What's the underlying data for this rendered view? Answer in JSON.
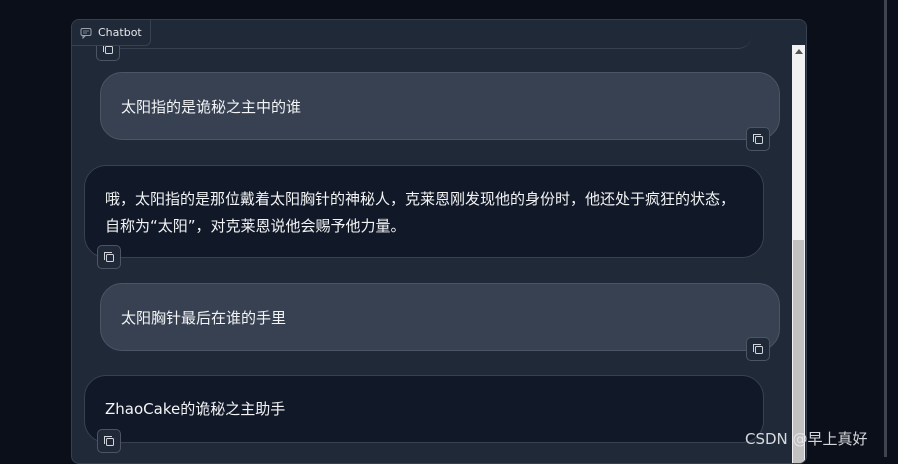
{
  "panel": {
    "label": "Chatbot",
    "label_icon": "chat-icon"
  },
  "messages": [
    {
      "role": "user",
      "text": "太阳指的是诡秘之主中的谁"
    },
    {
      "role": "bot",
      "text": "哦，太阳指的是那位戴着太阳胸针的神秘人，克莱恩刚发现他的身份时，他还处于疯狂的状态，自称为“太阳”，对克莱恩说他会赐予他力量。"
    },
    {
      "role": "user",
      "text": "太阳胸针最后在谁的手里"
    },
    {
      "role": "bot",
      "text": "ZhaoCake的诡秘之主助手"
    }
  ],
  "copy_icon": "copy-icon",
  "watermark": "CSDN @早上真好",
  "colors": {
    "background": "#0b0f19",
    "panel": "#1f2937",
    "user_bubble": "#374151",
    "bot_bubble": "#111827"
  }
}
